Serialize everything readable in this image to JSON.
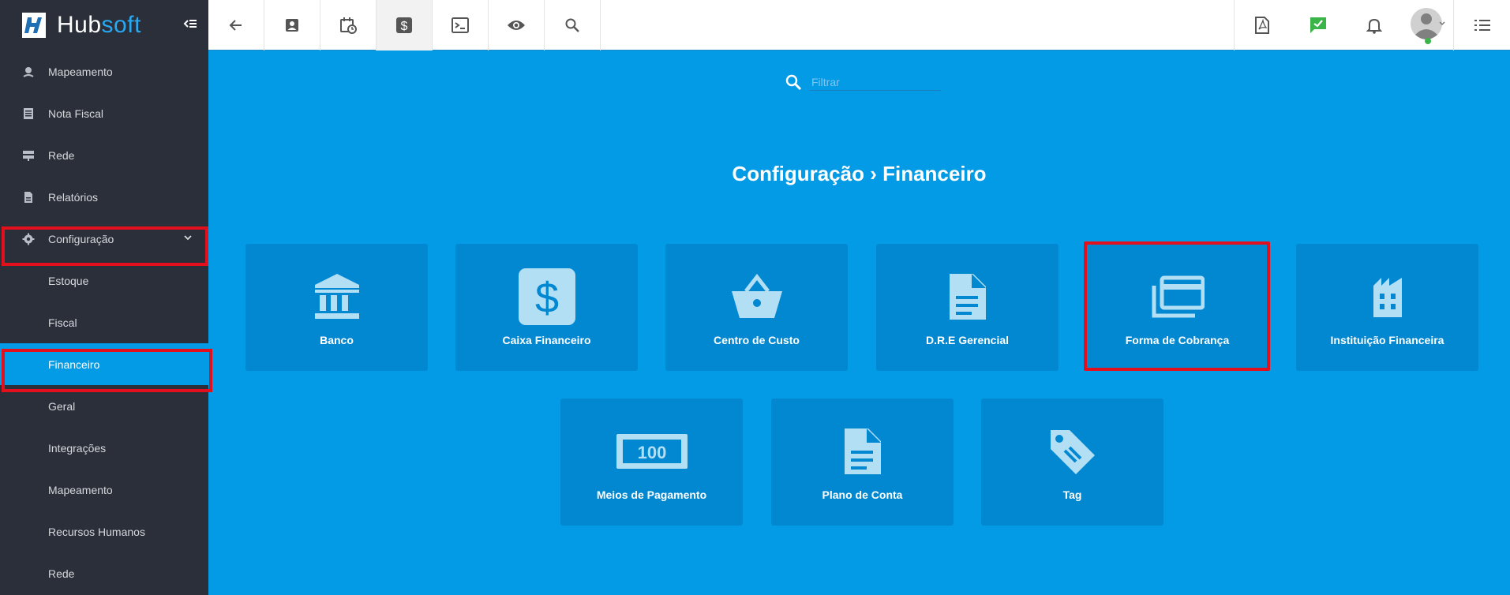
{
  "brand": {
    "name_part1": "Hub",
    "name_part2": "soft"
  },
  "sidebar": {
    "items": [
      {
        "label": "Mapeamento",
        "icon": "map-pin-icon"
      },
      {
        "label": "Nota Fiscal",
        "icon": "receipt-icon"
      },
      {
        "label": "Rede",
        "icon": "server-icon"
      },
      {
        "label": "Relatórios",
        "icon": "document-icon"
      },
      {
        "label": "Configuração",
        "icon": "gear-icon"
      },
      {
        "label": "Estoque"
      },
      {
        "label": "Fiscal"
      },
      {
        "label": "Financeiro"
      },
      {
        "label": "Geral"
      },
      {
        "label": "Integrações"
      },
      {
        "label": "Mapeamento"
      },
      {
        "label": "Recursos Humanos"
      },
      {
        "label": "Rede"
      }
    ]
  },
  "topbar": {
    "left_icons": [
      "back-arrow-icon",
      "contact-card-icon",
      "calendar-clock-icon",
      "dollar-icon",
      "terminal-icon",
      "eye-icon",
      "search-icon"
    ],
    "right_icons": [
      "pdf-icon",
      "chat-check-icon",
      "bell-icon",
      "user-avatar",
      "list-menu-icon"
    ]
  },
  "main": {
    "filter_placeholder": "Filtrar",
    "title": "Configuração › Financeiro",
    "cards": [
      {
        "label": "Banco",
        "icon": "bank-icon"
      },
      {
        "label": "Caixa Financeiro",
        "icon": "dollar-box-icon"
      },
      {
        "label": "Centro de Custo",
        "icon": "basket-icon"
      },
      {
        "label": "D.R.E Gerencial",
        "icon": "file-icon"
      },
      {
        "label": "Forma de Cobrança",
        "icon": "credit-cards-icon"
      },
      {
        "label": "Instituição Financeira",
        "icon": "building-icon"
      },
      {
        "label": "Meios de Pagamento",
        "icon": "banknote-100-icon",
        "badge": "100"
      },
      {
        "label": "Plano de Conta",
        "icon": "file-icon"
      },
      {
        "label": "Tag",
        "icon": "tag-icon"
      }
    ]
  },
  "colors": {
    "accent": "#039be5",
    "card": "#0288d1",
    "sidebar_bg": "#2b2f3a",
    "highlight": "#e2101c",
    "icon_light": "#b3dff5"
  }
}
